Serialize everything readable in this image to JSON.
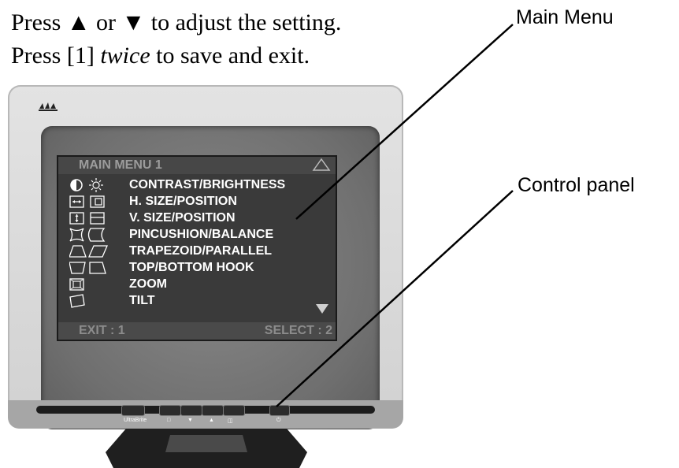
{
  "instructions": {
    "line1_a": "Press ",
    "line1_up": "▲",
    "line1_b": " or ",
    "line1_down": "▼",
    "line1_c": " to adjust the setting.",
    "line2_a": "Press [1] ",
    "line2_em": "twice",
    "line2_b": " to save and exit."
  },
  "callouts": {
    "main_menu": "Main Menu",
    "control_panel": "Control panel"
  },
  "osd": {
    "title": "MAIN MENU 1",
    "items": [
      {
        "label": "CONTRAST/BRIGHTNESS",
        "icon": "contrast-brightness-icon"
      },
      {
        "label": "H. SIZE/POSITION",
        "icon": "h-size-position-icon"
      },
      {
        "label": "V. SIZE/POSITION",
        "icon": "v-size-position-icon"
      },
      {
        "label": "PINCUSHION/BALANCE",
        "icon": "pincushion-balance-icon"
      },
      {
        "label": "TRAPEZOID/PARALLEL",
        "icon": "trapezoid-parallel-icon"
      },
      {
        "label": "TOP/BOTTOM HOOK",
        "icon": "top-bottom-hook-icon"
      },
      {
        "label": "ZOOM",
        "icon": "zoom-icon"
      },
      {
        "label": "TILT",
        "icon": "tilt-icon"
      }
    ],
    "exit_label": "EXIT : 1",
    "select_label": "SELECT : 2"
  },
  "control_panel": {
    "ultrabrite_label": "UltraBrite"
  },
  "colors": {
    "osd_background": "#3a3a3a",
    "osd_text": "#ffffff",
    "osd_dim_text": "#9c9c9c",
    "bezel": "#dcdcdc",
    "panel": "#a6a6a6"
  }
}
